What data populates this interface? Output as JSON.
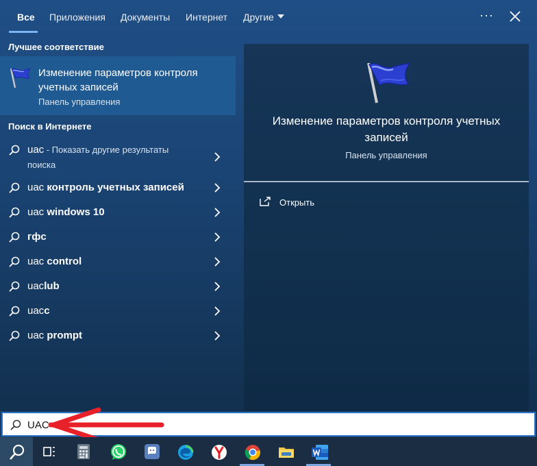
{
  "tabs": {
    "all": "Все",
    "apps": "Приложения",
    "documents": "Документы",
    "internet": "Интернет",
    "other": "Другие",
    "more": "···"
  },
  "left": {
    "best_match_header": "Лучшее соответствие",
    "best_match": {
      "title": "Изменение параметров контроля учетных записей",
      "subtitle": "Панель управления"
    },
    "web_header": "Поиск в Интернете",
    "web_first": {
      "prefix": "uac",
      "suffix": " - Показать другие результаты",
      "line2": "поиска"
    },
    "suggestions": [
      {
        "prefix": "uac ",
        "bold": "контроль учетных записей"
      },
      {
        "prefix": "uac ",
        "bold": "windows 10"
      },
      {
        "prefix": "",
        "bold": "гфс"
      },
      {
        "prefix": "uac ",
        "bold": "control"
      },
      {
        "prefix": "uac",
        "bold": "lub"
      },
      {
        "prefix": "uac",
        "bold": "c"
      },
      {
        "prefix": "uac ",
        "bold": "prompt"
      }
    ]
  },
  "right": {
    "title": "Изменение параметров контроля учетных записей",
    "subtitle": "Панель управления",
    "open_label": "Открыть"
  },
  "search": {
    "value": "UAC"
  },
  "colors": {
    "accent": "#7ab4f5",
    "arrow": "#e8202a",
    "panel": "#1f4e86"
  }
}
